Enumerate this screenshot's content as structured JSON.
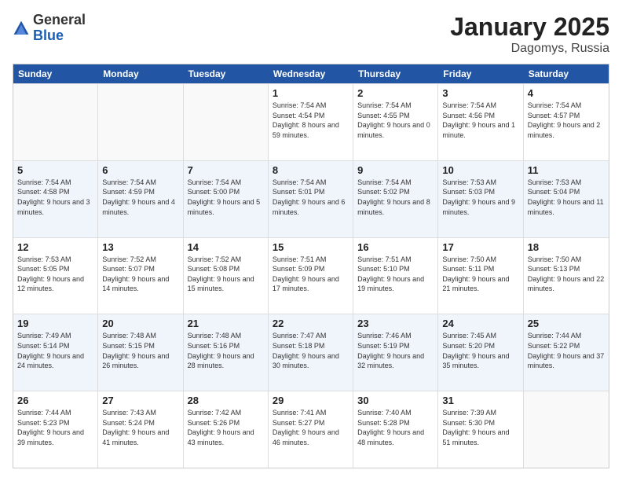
{
  "logo": {
    "general": "General",
    "blue": "Blue"
  },
  "title": "January 2025",
  "subtitle": "Dagomys, Russia",
  "header_days": [
    "Sunday",
    "Monday",
    "Tuesday",
    "Wednesday",
    "Thursday",
    "Friday",
    "Saturday"
  ],
  "weeks": [
    [
      {
        "day": "",
        "sunrise": "",
        "sunset": "",
        "daylight": "",
        "empty": true
      },
      {
        "day": "",
        "sunrise": "",
        "sunset": "",
        "daylight": "",
        "empty": true
      },
      {
        "day": "",
        "sunrise": "",
        "sunset": "",
        "daylight": "",
        "empty": true
      },
      {
        "day": "1",
        "sunrise": "Sunrise: 7:54 AM",
        "sunset": "Sunset: 4:54 PM",
        "daylight": "Daylight: 8 hours and 59 minutes.",
        "empty": false
      },
      {
        "day": "2",
        "sunrise": "Sunrise: 7:54 AM",
        "sunset": "Sunset: 4:55 PM",
        "daylight": "Daylight: 9 hours and 0 minutes.",
        "empty": false
      },
      {
        "day": "3",
        "sunrise": "Sunrise: 7:54 AM",
        "sunset": "Sunset: 4:56 PM",
        "daylight": "Daylight: 9 hours and 1 minute.",
        "empty": false
      },
      {
        "day": "4",
        "sunrise": "Sunrise: 7:54 AM",
        "sunset": "Sunset: 4:57 PM",
        "daylight": "Daylight: 9 hours and 2 minutes.",
        "empty": false
      }
    ],
    [
      {
        "day": "5",
        "sunrise": "Sunrise: 7:54 AM",
        "sunset": "Sunset: 4:58 PM",
        "daylight": "Daylight: 9 hours and 3 minutes.",
        "empty": false
      },
      {
        "day": "6",
        "sunrise": "Sunrise: 7:54 AM",
        "sunset": "Sunset: 4:59 PM",
        "daylight": "Daylight: 9 hours and 4 minutes.",
        "empty": false
      },
      {
        "day": "7",
        "sunrise": "Sunrise: 7:54 AM",
        "sunset": "Sunset: 5:00 PM",
        "daylight": "Daylight: 9 hours and 5 minutes.",
        "empty": false
      },
      {
        "day": "8",
        "sunrise": "Sunrise: 7:54 AM",
        "sunset": "Sunset: 5:01 PM",
        "daylight": "Daylight: 9 hours and 6 minutes.",
        "empty": false
      },
      {
        "day": "9",
        "sunrise": "Sunrise: 7:54 AM",
        "sunset": "Sunset: 5:02 PM",
        "daylight": "Daylight: 9 hours and 8 minutes.",
        "empty": false
      },
      {
        "day": "10",
        "sunrise": "Sunrise: 7:53 AM",
        "sunset": "Sunset: 5:03 PM",
        "daylight": "Daylight: 9 hours and 9 minutes.",
        "empty": false
      },
      {
        "day": "11",
        "sunrise": "Sunrise: 7:53 AM",
        "sunset": "Sunset: 5:04 PM",
        "daylight": "Daylight: 9 hours and 11 minutes.",
        "empty": false
      }
    ],
    [
      {
        "day": "12",
        "sunrise": "Sunrise: 7:53 AM",
        "sunset": "Sunset: 5:05 PM",
        "daylight": "Daylight: 9 hours and 12 minutes.",
        "empty": false
      },
      {
        "day": "13",
        "sunrise": "Sunrise: 7:52 AM",
        "sunset": "Sunset: 5:07 PM",
        "daylight": "Daylight: 9 hours and 14 minutes.",
        "empty": false
      },
      {
        "day": "14",
        "sunrise": "Sunrise: 7:52 AM",
        "sunset": "Sunset: 5:08 PM",
        "daylight": "Daylight: 9 hours and 15 minutes.",
        "empty": false
      },
      {
        "day": "15",
        "sunrise": "Sunrise: 7:51 AM",
        "sunset": "Sunset: 5:09 PM",
        "daylight": "Daylight: 9 hours and 17 minutes.",
        "empty": false
      },
      {
        "day": "16",
        "sunrise": "Sunrise: 7:51 AM",
        "sunset": "Sunset: 5:10 PM",
        "daylight": "Daylight: 9 hours and 19 minutes.",
        "empty": false
      },
      {
        "day": "17",
        "sunrise": "Sunrise: 7:50 AM",
        "sunset": "Sunset: 5:11 PM",
        "daylight": "Daylight: 9 hours and 21 minutes.",
        "empty": false
      },
      {
        "day": "18",
        "sunrise": "Sunrise: 7:50 AM",
        "sunset": "Sunset: 5:13 PM",
        "daylight": "Daylight: 9 hours and 22 minutes.",
        "empty": false
      }
    ],
    [
      {
        "day": "19",
        "sunrise": "Sunrise: 7:49 AM",
        "sunset": "Sunset: 5:14 PM",
        "daylight": "Daylight: 9 hours and 24 minutes.",
        "empty": false
      },
      {
        "day": "20",
        "sunrise": "Sunrise: 7:48 AM",
        "sunset": "Sunset: 5:15 PM",
        "daylight": "Daylight: 9 hours and 26 minutes.",
        "empty": false
      },
      {
        "day": "21",
        "sunrise": "Sunrise: 7:48 AM",
        "sunset": "Sunset: 5:16 PM",
        "daylight": "Daylight: 9 hours and 28 minutes.",
        "empty": false
      },
      {
        "day": "22",
        "sunrise": "Sunrise: 7:47 AM",
        "sunset": "Sunset: 5:18 PM",
        "daylight": "Daylight: 9 hours and 30 minutes.",
        "empty": false
      },
      {
        "day": "23",
        "sunrise": "Sunrise: 7:46 AM",
        "sunset": "Sunset: 5:19 PM",
        "daylight": "Daylight: 9 hours and 32 minutes.",
        "empty": false
      },
      {
        "day": "24",
        "sunrise": "Sunrise: 7:45 AM",
        "sunset": "Sunset: 5:20 PM",
        "daylight": "Daylight: 9 hours and 35 minutes.",
        "empty": false
      },
      {
        "day": "25",
        "sunrise": "Sunrise: 7:44 AM",
        "sunset": "Sunset: 5:22 PM",
        "daylight": "Daylight: 9 hours and 37 minutes.",
        "empty": false
      }
    ],
    [
      {
        "day": "26",
        "sunrise": "Sunrise: 7:44 AM",
        "sunset": "Sunset: 5:23 PM",
        "daylight": "Daylight: 9 hours and 39 minutes.",
        "empty": false
      },
      {
        "day": "27",
        "sunrise": "Sunrise: 7:43 AM",
        "sunset": "Sunset: 5:24 PM",
        "daylight": "Daylight: 9 hours and 41 minutes.",
        "empty": false
      },
      {
        "day": "28",
        "sunrise": "Sunrise: 7:42 AM",
        "sunset": "Sunset: 5:26 PM",
        "daylight": "Daylight: 9 hours and 43 minutes.",
        "empty": false
      },
      {
        "day": "29",
        "sunrise": "Sunrise: 7:41 AM",
        "sunset": "Sunset: 5:27 PM",
        "daylight": "Daylight: 9 hours and 46 minutes.",
        "empty": false
      },
      {
        "day": "30",
        "sunrise": "Sunrise: 7:40 AM",
        "sunset": "Sunset: 5:28 PM",
        "daylight": "Daylight: 9 hours and 48 minutes.",
        "empty": false
      },
      {
        "day": "31",
        "sunrise": "Sunrise: 7:39 AM",
        "sunset": "Sunset: 5:30 PM",
        "daylight": "Daylight: 9 hours and 51 minutes.",
        "empty": false
      },
      {
        "day": "",
        "sunrise": "",
        "sunset": "",
        "daylight": "",
        "empty": true
      }
    ]
  ]
}
